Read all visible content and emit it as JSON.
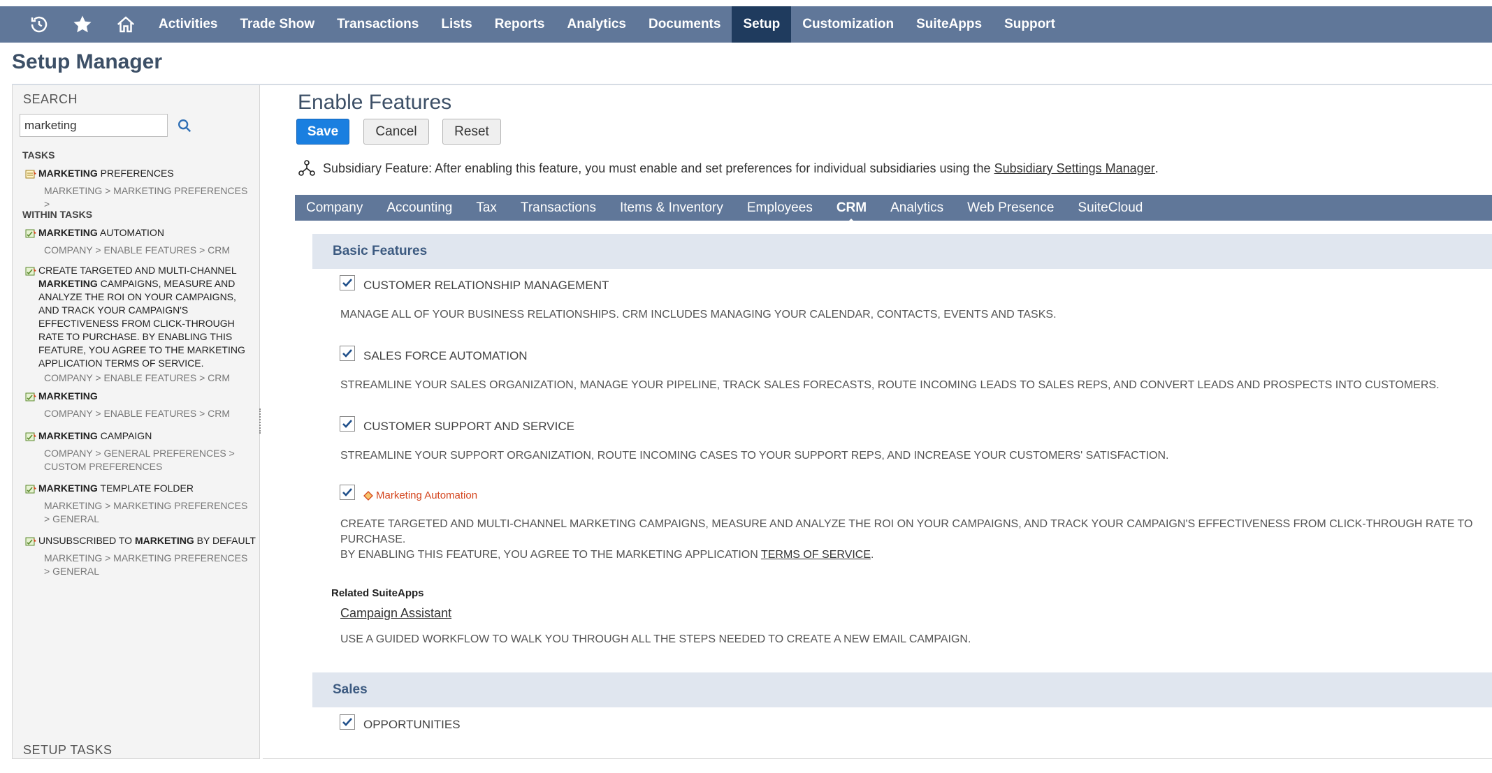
{
  "topnav": {
    "items": [
      {
        "label": "Activities",
        "active": false
      },
      {
        "label": "Trade Show",
        "active": false
      },
      {
        "label": "Transactions",
        "active": false
      },
      {
        "label": "Lists",
        "active": false
      },
      {
        "label": "Reports",
        "active": false
      },
      {
        "label": "Analytics",
        "active": false
      },
      {
        "label": "Documents",
        "active": false
      },
      {
        "label": "Setup",
        "active": true
      },
      {
        "label": "Customization",
        "active": false
      },
      {
        "label": "SuiteApps",
        "active": false
      },
      {
        "label": "Support",
        "active": false
      }
    ],
    "icons": [
      "recent-records-icon",
      "star-icon",
      "home-icon"
    ]
  },
  "page": {
    "title": "Setup Manager"
  },
  "left_panel": {
    "search_title": "SEARCH",
    "search_value": "marketing",
    "tasks_title": "TASKS",
    "within_tasks_title": "WITHIN TASKS",
    "setup_tasks_title": "SETUP TASKS",
    "task_results": [
      {
        "bold": "MARKETING",
        "rest": " PREFERENCES",
        "path": "MARKETING > MARKETING PREFERENCES >"
      }
    ],
    "within_results": [
      {
        "pre": "",
        "bold": "MARKETING",
        "rest": " AUTOMATION",
        "path": "COMPANY > ENABLE FEATURES > CRM"
      },
      {
        "pre": "CREATE TARGETED AND MULTI-CHANNEL ",
        "bold": "MARKETING",
        "rest": " CAMPAIGNS, MEASURE AND ANALYZE THE ROI ON YOUR CAMPAIGNS, AND TRACK YOUR CAMPAIGN'S EFFECTIVENESS FROM CLICK-THROUGH RATE TO PURCHASE. BY ENABLING THIS FEATURE, YOU AGREE TO THE MARKETING APPLICATION TERMS OF SERVICE.",
        "path": "COMPANY > ENABLE FEATURES > CRM"
      },
      {
        "pre": "",
        "bold": "MARKETING",
        "rest": "",
        "path": "COMPANY > ENABLE FEATURES > CRM"
      },
      {
        "pre": "",
        "bold": "MARKETING",
        "rest": " CAMPAIGN",
        "path": "COMPANY > GENERAL PREFERENCES > CUSTOM PREFERENCES"
      },
      {
        "pre": "",
        "bold": "MARKETING",
        "rest": " TEMPLATE FOLDER",
        "path": "MARKETING > MARKETING PREFERENCES > GENERAL"
      },
      {
        "pre": "UNSUBSCRIBED TO ",
        "bold": "MARKETING",
        "rest": " BY DEFAULT",
        "path": "MARKETING > MARKETING PREFERENCES > GENERAL"
      }
    ]
  },
  "main": {
    "title": "Enable Features",
    "buttons": {
      "save": "Save",
      "cancel": "Cancel",
      "reset": "Reset"
    },
    "subsidiary_note": "Subsidiary Feature: After enabling this feature, you must enable and set preferences for individual subsidiaries using the ",
    "subsidiary_link": "Subsidiary Settings Manager",
    "subsidiary_end": ".",
    "subtabs": [
      {
        "label": "Company",
        "active": false
      },
      {
        "label": "Accounting",
        "active": false
      },
      {
        "label": "Tax",
        "active": false
      },
      {
        "label": "Transactions",
        "active": false
      },
      {
        "label": "Items & Inventory",
        "active": false
      },
      {
        "label": "Employees",
        "active": false
      },
      {
        "label": "CRM",
        "active": true
      },
      {
        "label": "Analytics",
        "active": false
      },
      {
        "label": "Web Presence",
        "active": false
      },
      {
        "label": "SuiteCloud",
        "active": false
      }
    ],
    "sections": {
      "basic": "Basic Features",
      "sales": "Sales"
    },
    "features": [
      {
        "label": "CUSTOMER RELATIONSHIP MANAGEMENT",
        "checked": true,
        "desc": "MANAGE ALL OF YOUR BUSINESS RELATIONSHIPS. CRM INCLUDES MANAGING YOUR CALENDAR, CONTACTS, EVENTS AND TASKS."
      },
      {
        "label": "SALES FORCE AUTOMATION",
        "checked": true,
        "desc": "STREAMLINE YOUR SALES ORGANIZATION, MANAGE YOUR PIPELINE, TRACK SALES FORECASTS, ROUTE INCOMING LEADS TO SALES REPS, AND CONVERT LEADS AND PROSPECTS INTO CUSTOMERS."
      },
      {
        "label": "CUSTOMER SUPPORT AND SERVICE",
        "checked": true,
        "desc": "STREAMLINE YOUR SUPPORT ORGANIZATION, ROUTE INCOMING CASES TO YOUR SUPPORT REPS, AND INCREASE YOUR CUSTOMERS' SATISFACTION."
      },
      {
        "label": "Marketing Automation",
        "checked": true,
        "desc_line1": "CREATE TARGETED AND MULTI-CHANNEL MARKETING CAMPAIGNS, MEASURE AND ANALYZE THE ROI ON YOUR CAMPAIGNS, AND TRACK YOUR CAMPAIGN'S EFFECTIVENESS FROM CLICK-THROUGH RATE TO PURCHASE.",
        "desc_line2": "BY ENABLING THIS FEATURE, YOU AGREE TO THE MARKETING APPLICATION ",
        "desc_link": "TERMS OF SERVICE",
        "desc_end": "."
      },
      {
        "label": "OPPORTUNITIES",
        "checked": true
      }
    ],
    "related": {
      "title": "Related SuiteApps",
      "link": "Campaign Assistant",
      "desc": "USE A GUIDED WORKFLOW TO WALK YOU THROUGH ALL THE STEPS NEEDED TO CREATE A NEW EMAIL CAMPAIGN."
    }
  },
  "colors": {
    "nav_bg": "#607799",
    "nav_active": "#1f3b5e",
    "save_blue": "#1a7fe0",
    "section_bg": "#e0e6ef",
    "highlight_orange": "#d4461f"
  }
}
